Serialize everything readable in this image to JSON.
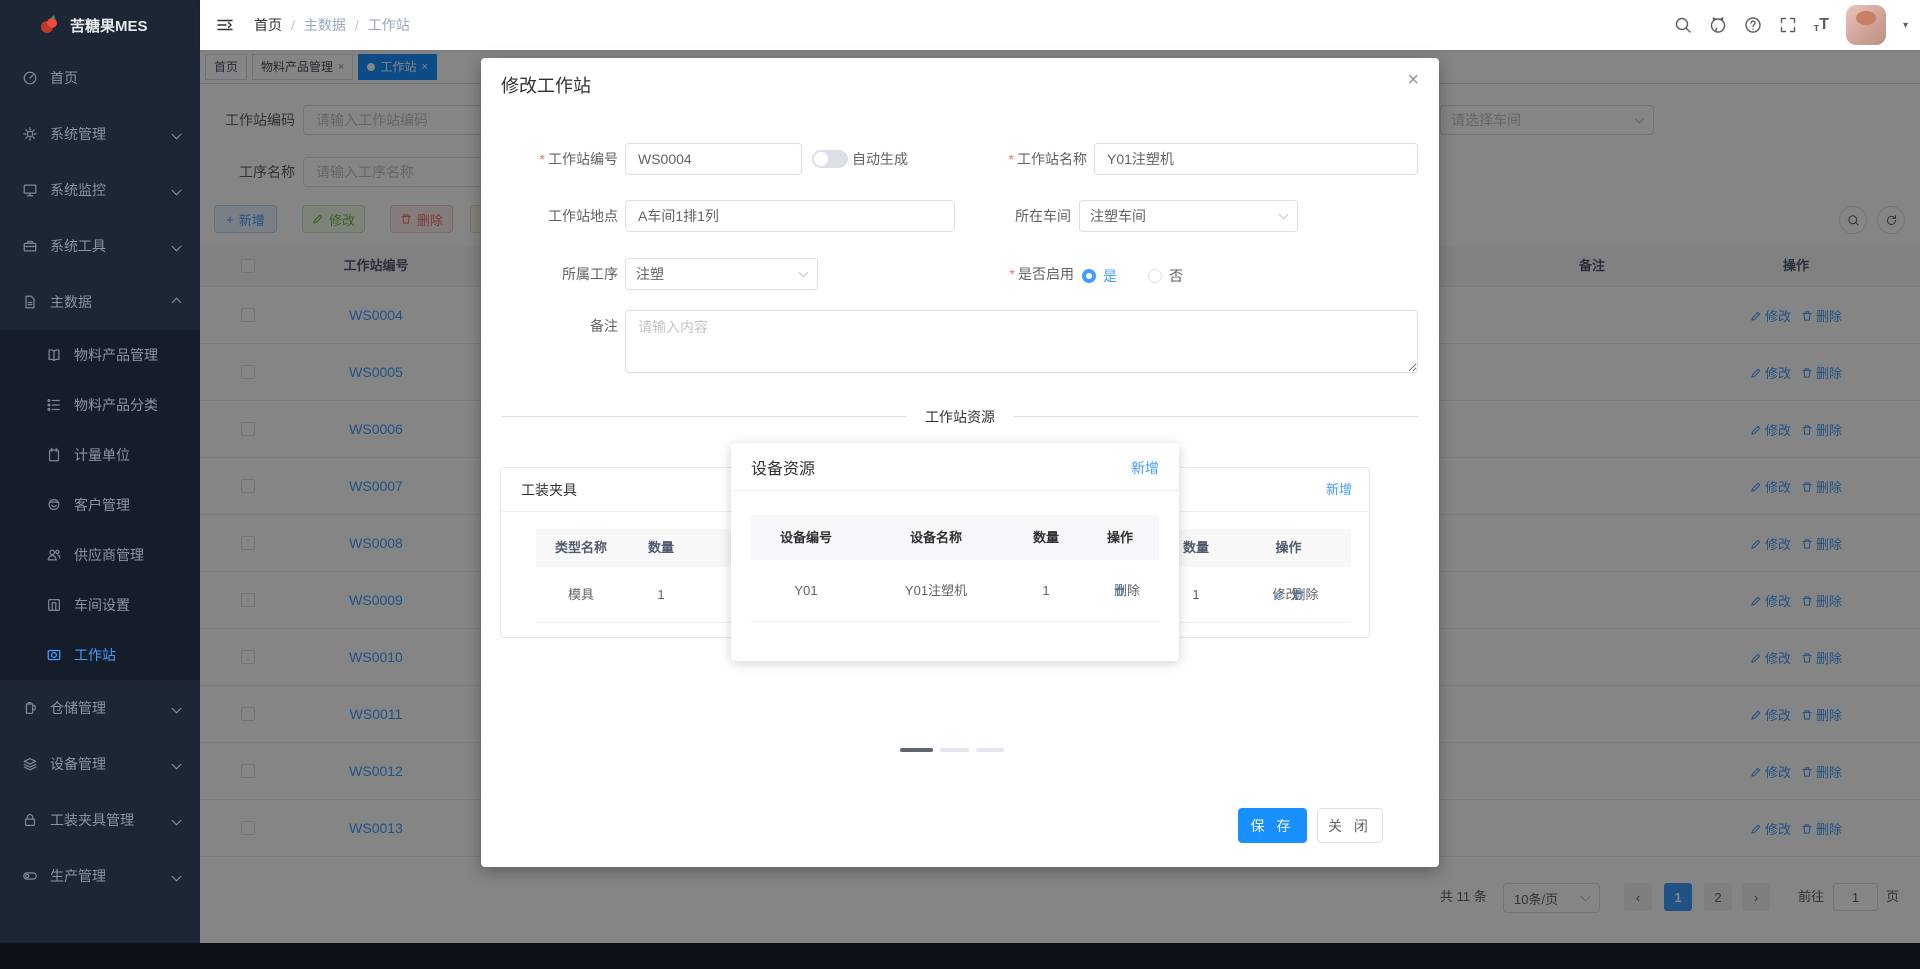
{
  "colors": {
    "primary": "#1890ff",
    "link": "#409eff",
    "success": "#67c23a",
    "danger": "#f56c6c",
    "warning": "#e6a23c",
    "sidebar_bg": "#1c2634",
    "submenu_bg": "#151d2a"
  },
  "brand": {
    "title": "苦糖果MES"
  },
  "sidebar": {
    "items": [
      {
        "name": "home",
        "label": "首页",
        "icon": "dashboard-icon",
        "sub": false,
        "chevron": "none",
        "active": false
      },
      {
        "name": "system-mgmt",
        "label": "系统管理",
        "icon": "gear-icon",
        "sub": false,
        "chevron": "down",
        "active": false
      },
      {
        "name": "system-monitor",
        "label": "系统监控",
        "icon": "monitor-icon",
        "sub": false,
        "chevron": "down",
        "active": false
      },
      {
        "name": "system-tools",
        "label": "系统工具",
        "icon": "toolbox-icon",
        "sub": false,
        "chevron": "down",
        "active": false
      },
      {
        "name": "master-data",
        "label": "主数据",
        "icon": "document-icon",
        "sub": false,
        "chevron": "up",
        "active": false
      },
      {
        "name": "material-product-mgmt",
        "label": "物料产品管理",
        "icon": "book-icon",
        "sub": true,
        "chevron": "none",
        "active": false
      },
      {
        "name": "material-product-category",
        "label": "物料产品分类",
        "icon": "category-icon",
        "sub": true,
        "chevron": "none",
        "active": false
      },
      {
        "name": "measure-unit",
        "label": "计量单位",
        "icon": "notebook-icon",
        "sub": true,
        "chevron": "none",
        "active": false
      },
      {
        "name": "customer-mgmt",
        "label": "客户管理",
        "icon": "customer-icon",
        "sub": true,
        "chevron": "none",
        "active": false
      },
      {
        "name": "supplier-mgmt",
        "label": "供应商管理",
        "icon": "supplier-icon",
        "sub": true,
        "chevron": "none",
        "active": false
      },
      {
        "name": "workshop-settings",
        "label": "车间设置",
        "icon": "door-icon",
        "sub": true,
        "chevron": "none",
        "active": false
      },
      {
        "name": "workstation",
        "label": "工作站",
        "icon": "workstation-icon",
        "sub": true,
        "chevron": "none",
        "active": true
      },
      {
        "name": "warehouse-mgmt",
        "label": "仓储管理",
        "icon": "jug-icon",
        "sub": false,
        "chevron": "down",
        "active": false
      },
      {
        "name": "equipment-mgmt",
        "label": "设备管理",
        "icon": "layers-icon",
        "sub": false,
        "chevron": "down",
        "active": false
      },
      {
        "name": "fixture-mgmt",
        "label": "工装夹具管理",
        "icon": "lock-icon",
        "sub": false,
        "chevron": "down",
        "active": false
      },
      {
        "name": "production-mgmt",
        "label": "生产管理",
        "icon": "toggle-icon",
        "sub": false,
        "chevron": "down",
        "active": false
      }
    ]
  },
  "header": {
    "breadcrumb": [
      "首页",
      "主数据",
      "工作站"
    ],
    "separator": "/"
  },
  "tabs": {
    "items": [
      {
        "label": "首页",
        "closable": false,
        "active": false
      },
      {
        "label": "物料产品管理",
        "closable": true,
        "active": false
      },
      {
        "label": "工作站",
        "closable": true,
        "active": true
      }
    ],
    "close_glyph": "×"
  },
  "filters": {
    "code_label": "工作站编码",
    "code_placeholder": "请输入工作站编码",
    "process_label": "工序名称",
    "process_placeholder": "请输入工序名称",
    "workshop_placeholder": "请选择车间"
  },
  "toolbar": {
    "add": "新增",
    "edit": "修改",
    "delete": "删除"
  },
  "table": {
    "header_checkbox": true,
    "headers": [
      "工作站编号",
      "备注",
      "操作"
    ],
    "rows": [
      "WS0004",
      "WS0005",
      "WS0006",
      "WS0007",
      "WS0008",
      "WS0009",
      "WS0010",
      "WS0011",
      "WS0012",
      "WS0013"
    ],
    "row_actions": {
      "edit": "修改",
      "delete": "删除"
    }
  },
  "pagination": {
    "total": "共 11 条",
    "page_size": "10条/页",
    "prev": "‹",
    "next": "›",
    "pages": [
      "1",
      "2"
    ],
    "current": "1",
    "goto_label": "前往",
    "goto_value": "1",
    "unit": "页"
  },
  "dialog": {
    "title": "修改工作站",
    "close_glyph": "×",
    "fields": {
      "code": {
        "label": "工作站编号",
        "required": true,
        "value": "WS0004"
      },
      "auto_generate": {
        "label": "自动生成",
        "state": "off"
      },
      "name": {
        "label": "工作站名称",
        "required": true,
        "value": "Y01注塑机"
      },
      "location": {
        "label": "工作站地点",
        "value": "A车间1排1列"
      },
      "workshop": {
        "label": "所在车间",
        "value": "注塑车间"
      },
      "process": {
        "label": "所属工序",
        "value": "注塑"
      },
      "enabled": {
        "label": "是否启用",
        "required": true,
        "yes": "是",
        "no": "否",
        "selected": "是"
      },
      "remark": {
        "label": "备注",
        "placeholder": "请输入内容"
      }
    },
    "divider": "工作站资源",
    "fixture_panel": {
      "title": "工装夹具",
      "headers": [
        "类型名称",
        "数量",
        "操作"
      ],
      "row": {
        "type": "模具",
        "qty": "1"
      },
      "actions": {
        "edit": "修改",
        "delete": "删除"
      }
    },
    "right_panel": {
      "add": "新增",
      "headers": [
        "数量",
        "操作"
      ],
      "row": {
        "qty": "1"
      },
      "actions": {
        "edit": "修改",
        "delete": "删除"
      }
    },
    "device_popup": {
      "title": "设备资源",
      "add": "新增",
      "headers": [
        "设备编号",
        "设备名称",
        "数量",
        "操作"
      ],
      "row": {
        "code": "Y01",
        "name": "Y01注塑机",
        "qty": "1"
      },
      "actions": {
        "delete": "删除"
      }
    },
    "footer": {
      "save": "保 存",
      "close": "关 闭"
    }
  }
}
